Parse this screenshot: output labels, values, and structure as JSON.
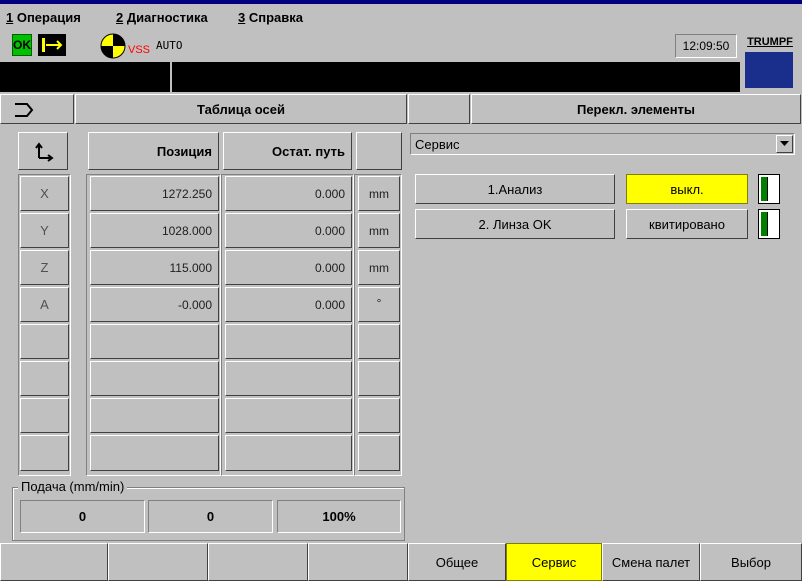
{
  "menu": {
    "items": [
      {
        "num": "1",
        "label": " Операция"
      },
      {
        "num": "2",
        "label": " Диагностика"
      },
      {
        "num": "3",
        "label": " Справка"
      }
    ]
  },
  "status": {
    "ok_label": "OK",
    "vss_label": "VSS",
    "mode_label": "AUTO",
    "time": "12:09:50",
    "brand": "TRUMPF",
    "colors": {
      "ok_green": "#00c000",
      "vss_red": "#ff0000",
      "brand_blue": "#1a2e8c"
    }
  },
  "axes_panel": {
    "title": "Таблица осей",
    "columns": {
      "position": "Позиция",
      "remaining": "Остат. путь"
    },
    "rows": [
      {
        "axis": "X",
        "position": "1272.250",
        "remaining": "0.000",
        "unit": "mm"
      },
      {
        "axis": "Y",
        "position": "1028.000",
        "remaining": "0.000",
        "unit": "mm"
      },
      {
        "axis": "Z",
        "position": "115.000",
        "remaining": "0.000",
        "unit": "mm"
      },
      {
        "axis": "A",
        "position": "-0.000",
        "remaining": "0.000",
        "unit": "°"
      }
    ],
    "feed": {
      "label": "Подача (mm/min)",
      "values": [
        "0",
        "0",
        "100%"
      ]
    }
  },
  "switch_panel": {
    "title": "Перекл. элементы",
    "dropdown_value": "Сервис",
    "items": [
      {
        "label": "1.Анализ",
        "state": "выкл.",
        "state_color": "#ffff00"
      },
      {
        "label": "2. Линза OK",
        "state": "квитировано",
        "state_color": "#c0c0c0"
      }
    ]
  },
  "softkeys": {
    "left": [
      "",
      "",
      "",
      ""
    ],
    "right": [
      "Общее",
      "Сервис",
      "Смена палет",
      "Выбор"
    ],
    "active": "Сервис",
    "active_color": "#ffff00"
  }
}
